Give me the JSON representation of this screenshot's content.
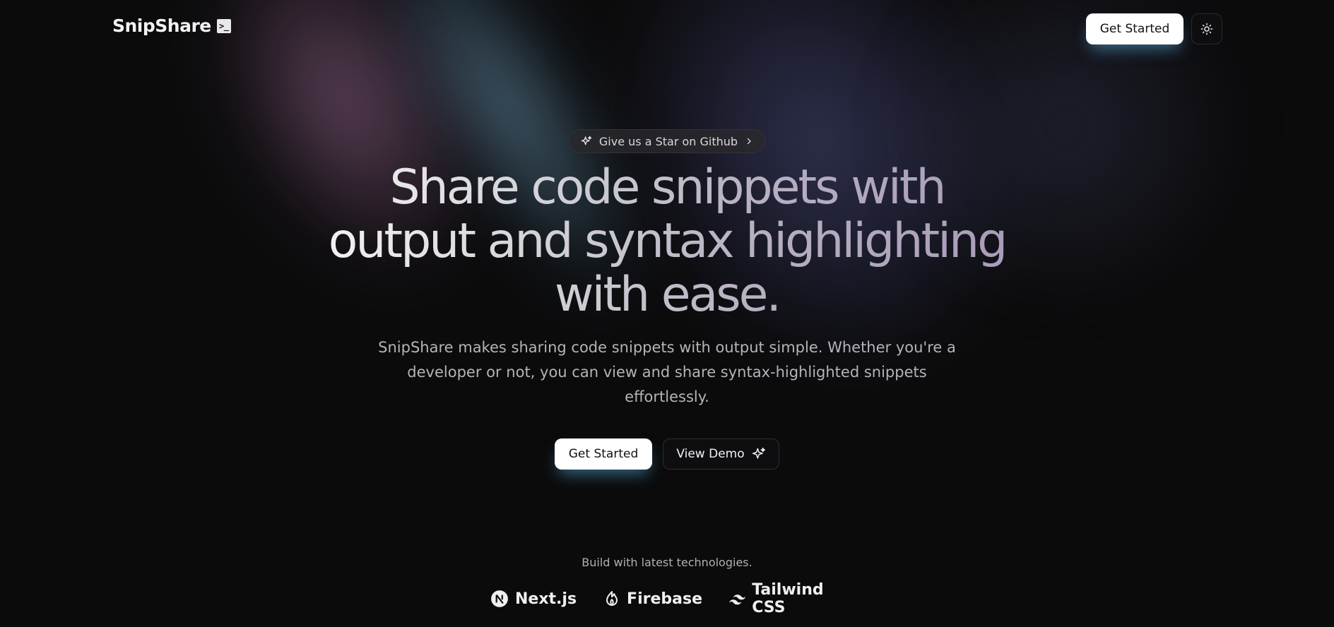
{
  "header": {
    "logo_text": "SnipShare",
    "logo_badge": ">_",
    "get_started_label": "Get Started",
    "theme_toggle_icon": "sun-icon"
  },
  "hero": {
    "github_pill": {
      "icon": "sparkle-icon",
      "label": "Give us a Star on Github",
      "chevron": "chevron-right-icon"
    },
    "headline": "Share code snippets with output and syntax highlighting with ease.",
    "description": "SnipShare makes sharing code snippets with output simple. Whether you're a developer or not, you can view and share syntax-highlighted snippets effortlessly.",
    "primary_cta": "Get Started",
    "secondary_cta": "View Demo",
    "secondary_cta_icon": "sparkle-icon"
  },
  "tech": {
    "title": "Build with latest technologies.",
    "items": [
      {
        "label": "Next.js",
        "icon": "nextjs-icon"
      },
      {
        "label": "Firebase",
        "icon": "firebase-icon"
      },
      {
        "label": "Tailwind CSS",
        "icon": "tailwind-icon"
      }
    ]
  },
  "colors": {
    "background": "#0b0b0c",
    "button_glow": "#5ab4e6",
    "headline_gradient_end": "#a99bb8"
  }
}
